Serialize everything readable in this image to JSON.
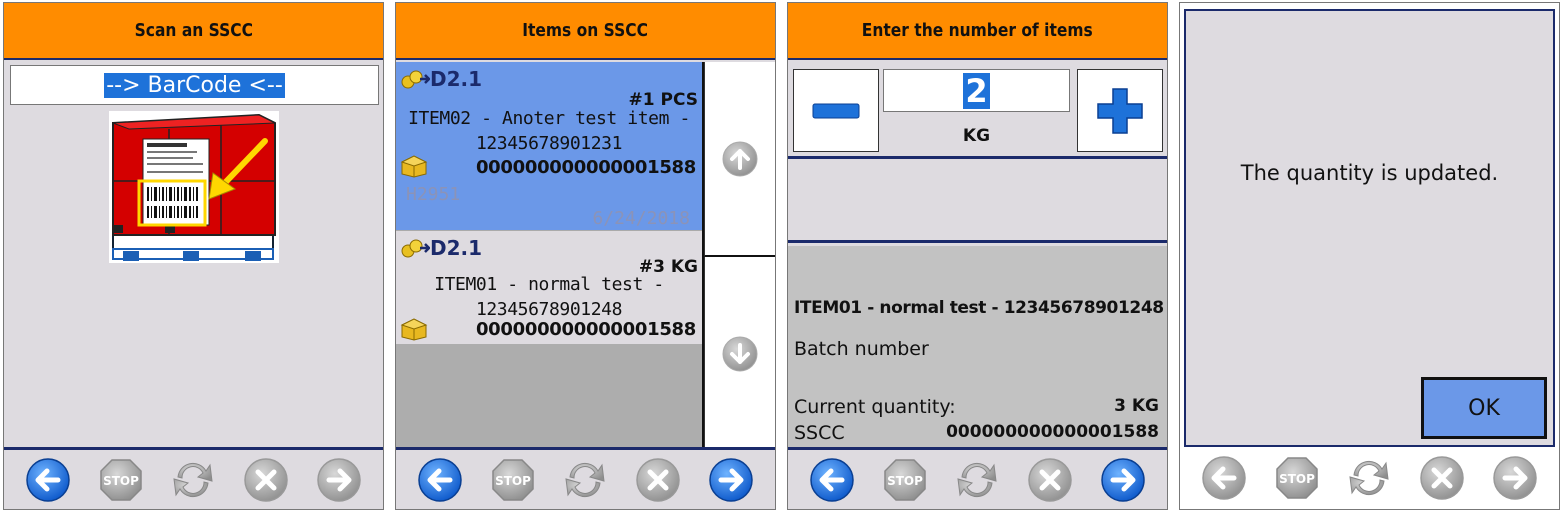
{
  "colors": {
    "header": "#ff8c00",
    "accent_blue": "#1e72d9",
    "selected_row": "#6b98e8",
    "panel": "#dedbe0",
    "navy": "#1b2a6b"
  },
  "screen1": {
    "title": "Scan an SSCC",
    "barcode_text": "--> BarCode <--"
  },
  "screen2": {
    "title": "Items on SSCC",
    "items": [
      {
        "location": "D2.1",
        "quantity": "#1 PCS",
        "name_line1": "ITEM02 - Anoter test item -",
        "name_line2": "12345678901231",
        "sscc": "000000000000001588",
        "batch": "H2951",
        "date": "6/24/2018"
      },
      {
        "location": "D2.1",
        "quantity": "#3 KG",
        "name_line1": "ITEM01 - normal test -",
        "name_line2": "12345678901248",
        "sscc": "000000000000001588"
      }
    ]
  },
  "screen3": {
    "title": "Enter the number of items",
    "quantity_value": "2",
    "unit": "KG",
    "item_title": "ITEM01 - normal test - 12345678901248",
    "batch_label": "Batch number",
    "current_qty_label": "Current quantity:",
    "current_qty_value": "3 KG",
    "sscc_label": "SSCC",
    "sscc_value": "000000000000001588"
  },
  "screen4": {
    "message": "The quantity is updated.",
    "ok_label": "OK"
  },
  "toolbar_icons": [
    "back-arrow-icon",
    "stop-icon",
    "refresh-icon",
    "cancel-icon",
    "forward-arrow-icon"
  ],
  "stop_label": "STOP"
}
